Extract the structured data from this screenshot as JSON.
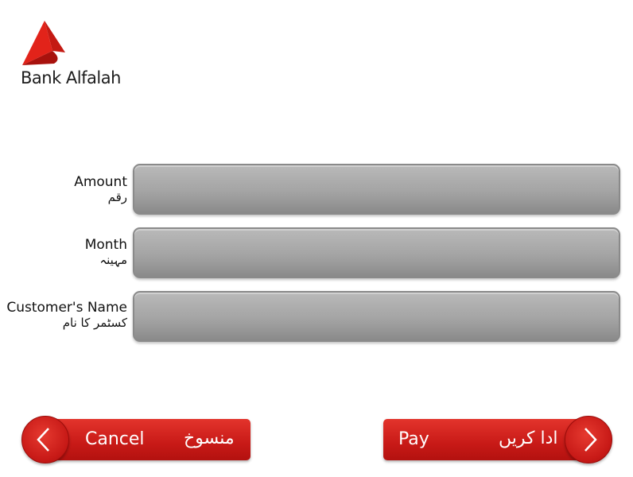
{
  "brand": {
    "name": "Bank Alfalah",
    "accent": "#d52b1e"
  },
  "fields": [
    {
      "label_en": "Amount",
      "label_ur": "رقم",
      "value": ""
    },
    {
      "label_en": "Month",
      "label_ur": "مہینہ",
      "value": ""
    },
    {
      "label_en": "Customer's Name",
      "label_ur": "کسٹمر کا نام",
      "value": ""
    }
  ],
  "buttons": {
    "cancel": {
      "label_en": "Cancel",
      "label_ur": "منسوخ",
      "icon": "chevron-left-icon"
    },
    "pay": {
      "label_en": "Pay",
      "label_ur": "ادا کریں",
      "icon": "chevron-right-icon"
    }
  }
}
